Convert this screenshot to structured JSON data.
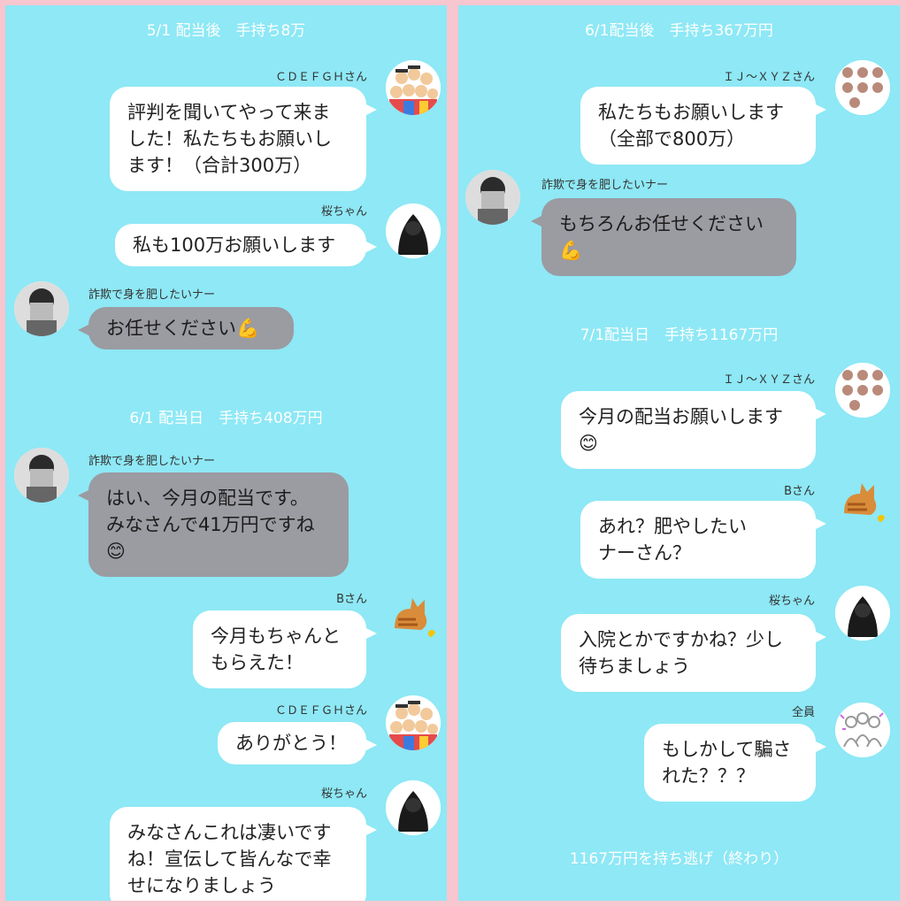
{
  "left": {
    "header1": "5/1 配当後　手持ち8万",
    "msg1_name": "ＣＤＥＦＧＨさん",
    "msg1_text": "評判を聞いてやって来ました！私たちもお願いします！（合計300万）",
    "msg2_name": "桜ちゃん",
    "msg2_text": "私も100万お願いします",
    "msg3_name": "詐欺で身を肥したいナー",
    "msg3_text": "お任せください💪",
    "header2": "6/1 配当日　手持ち408万円",
    "msg4_name": "詐欺で身を肥したいナー",
    "msg4_text": "はい、今月の配当です。\nみなさんで41万円ですね\n😊",
    "msg5_name": "Bさん",
    "msg5_text": "今月もちゃんと\nもらえた！",
    "msg6_name": "ＣＤＥＦＧＨさん",
    "msg6_text": "ありがとう！",
    "msg7_name": "桜ちゃん",
    "msg7_text": "みなさんこれは凄いですね！宣伝して皆んなで幸せになりましょう"
  },
  "right": {
    "header1": "6/1配当後　手持ち367万円",
    "msg1_name": "ＩＪ～ＸＹＺさん",
    "msg1_text": "私たちもお願いします\n（全部で800万）",
    "msg2_name": "詐欺で身を肥したいナー",
    "msg2_text": "もちろんお任せください\n💪",
    "header2": "7/1配当日　手持ち1167万円",
    "msg3_name": "ＩＪ～ＸＹＺさん",
    "msg3_text": "今月の配当お願いします\n😊",
    "msg4_name": "Bさん",
    "msg4_text": "あれ？肥やしたい\nナーさん？",
    "msg5_name": "桜ちゃん",
    "msg5_text": "入院とかですかね？少し\n待ちましょう",
    "msg6_name": "全員",
    "msg6_text": "もしかして騙さ\nれた？？？",
    "footer": "1167万円を持ち逃げ（終わり）"
  },
  "colors": {
    "panel_bg": "#8ee8f5",
    "border_pink": "#f7c6cf",
    "bubble_white": "#ffffff",
    "bubble_gray": "#9b9ba2",
    "header_text": "#ffffff"
  },
  "icons": [
    "crowd-avatar-icon",
    "hooded-figure-avatar-icon",
    "scammer-photo-avatar-icon",
    "cat-avatar-icon",
    "group-avatar-icon",
    "everyone-avatar-icon"
  ]
}
